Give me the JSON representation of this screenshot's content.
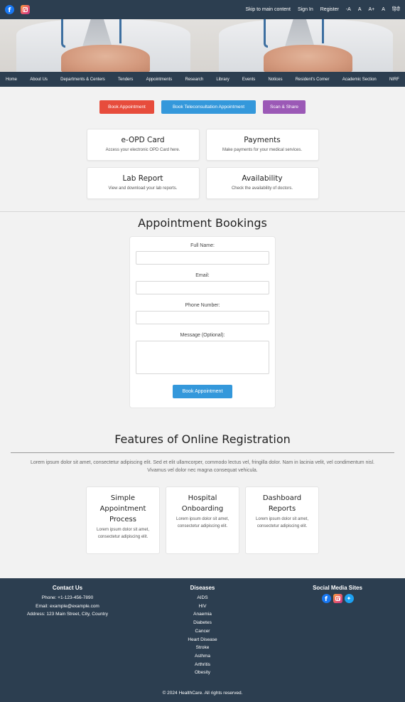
{
  "topbar": {
    "social_icons": [
      "facebook-icon",
      "instagram-icon"
    ],
    "links": [
      "Skip to main content",
      "Sign In",
      "Register",
      "-A",
      "A",
      "A+",
      "A",
      "हिंदी"
    ]
  },
  "hero": {
    "image_alt": "Doctor with stethoscope, hands clasped"
  },
  "nav": {
    "items": [
      "Home",
      "About Us",
      "Departments & Centers",
      "Tenders",
      "Appointments",
      "Research",
      "Library",
      "Events",
      "Notices",
      "Resident's Corner",
      "Academic Section",
      "NIRF"
    ]
  },
  "quick_actions": {
    "book_appointment": "Book Appointment",
    "book_teleconsultation": "Book Teleconsultation Appointment",
    "scan_share": "Scan & Share",
    "colors": {
      "red": "#e74c3c",
      "blue": "#3498db",
      "purple": "#9b59b6"
    }
  },
  "services": [
    {
      "title": "e-OPD Card",
      "desc": "Access your electronic OPD Card here."
    },
    {
      "title": "Payments",
      "desc": "Make payments for your medical services."
    },
    {
      "title": "Lab Report",
      "desc": "View and download your lab reports."
    },
    {
      "title": "Availability",
      "desc": "Check the availability of doctors."
    }
  ],
  "booking": {
    "title": "Appointment Bookings",
    "fields": {
      "full_name": {
        "label": "Full Name:",
        "value": ""
      },
      "email": {
        "label": "Email:",
        "value": ""
      },
      "phone": {
        "label": "Phone Number:",
        "value": ""
      },
      "message": {
        "label": "Message (Optional):",
        "value": ""
      }
    },
    "submit_label": "Book Appointment"
  },
  "features": {
    "title": "Features of Online Registration",
    "description": "Lorem ipsum dolor sit amet, consectetur adipiscing elit. Sed et elit ullamcorper, commodo lectus vel, fringilla dolor. Nam in lacinia velit, vel condimentum nisl. Vivamus vel dolor nec magna consequat vehicula.",
    "cards": [
      {
        "title": "Simple Appointment Process",
        "desc": "Lorem ipsum dolor sit amet, consectetur adipiscing elit."
      },
      {
        "title": "Hospital Onboarding",
        "desc": "Lorem ipsum dolor sit amet, consectetur adipiscing elit."
      },
      {
        "title": "Dashboard Reports",
        "desc": "Lorem ipsum dolor sit amet, consectetur adipiscing elit."
      }
    ]
  },
  "footer": {
    "contact": {
      "title": "Contact Us",
      "phone": "Phone: +1-123-456-7890",
      "email": "Email: example@example.com",
      "address": "Address: 123 Main Street, City, Country"
    },
    "diseases": {
      "title": "Diseases",
      "items": [
        "AIDS",
        "HIV",
        "Anaemia",
        "Diabetes",
        "Cancer",
        "Heart Disease",
        "Stroke",
        "Asthma",
        "Arthritis",
        "Obesity"
      ]
    },
    "social": {
      "title": "Social Media Sites",
      "icons": [
        "facebook-icon",
        "instagram-icon",
        "twitter-icon"
      ]
    },
    "copyright": "© 2024 HealthCare. All rights reserved."
  },
  "theme": {
    "header_bg": "#2c3e50",
    "page_bg": "#f2f2f2"
  }
}
